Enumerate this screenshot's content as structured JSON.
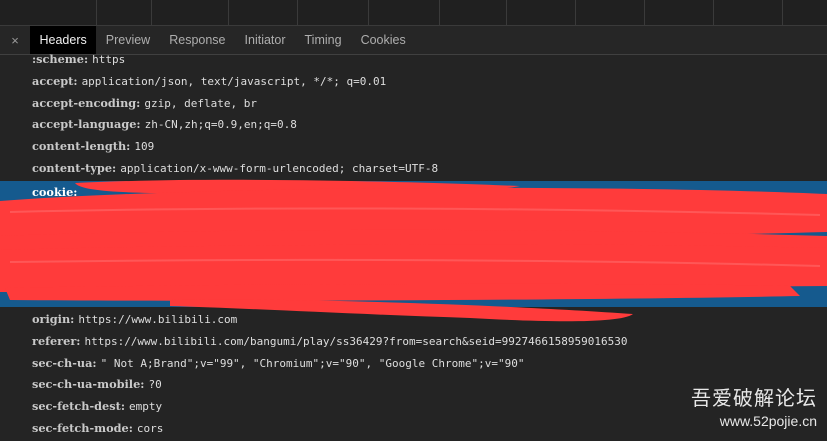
{
  "tabs": {
    "close_symbol": "×",
    "items": [
      {
        "label": "Headers",
        "active": true
      },
      {
        "label": "Preview"
      },
      {
        "label": "Response"
      },
      {
        "label": "Initiator"
      },
      {
        "label": "Timing"
      },
      {
        "label": "Cookies"
      }
    ]
  },
  "headers_top": [
    {
      "key": ":scheme:",
      "value": "https"
    },
    {
      "key": "accept:",
      "value": "application/json, text/javascript, */*; q=0.01"
    },
    {
      "key": "accept-encoding:",
      "value": "gzip, deflate, br"
    },
    {
      "key": "accept-language:",
      "value": "zh-CN,zh;q=0.9,en;q=0.8"
    },
    {
      "key": "content-length:",
      "value": "109"
    },
    {
      "key": "content-type:",
      "value": "application/x-www-form-urlencoded; charset=UTF-8"
    }
  ],
  "cookie_key": "cookie:",
  "headers_bottom": [
    {
      "key": "origin:",
      "value": "https://www.bilibili.com"
    },
    {
      "key": "referer:",
      "value": "https://www.bilibili.com/bangumi/play/ss36429?from=search&seid=9927466158959016530"
    },
    {
      "key": "sec-ch-ua:",
      "value": "\" Not A;Brand\";v=\"99\", \"Chromium\";v=\"90\", \"Google Chrome\";v=\"90\""
    },
    {
      "key": "sec-ch-ua-mobile:",
      "value": "?0"
    },
    {
      "key": "sec-fetch-dest:",
      "value": "empty"
    },
    {
      "key": "sec-fetch-mode:",
      "value": "cors"
    }
  ],
  "watermark": {
    "line1": "吾爱破解论坛",
    "line2": "www.52pojie.cn"
  },
  "colors": {
    "background": "#242424",
    "selection": "#155a8e",
    "redaction": "#ff3b3b"
  }
}
